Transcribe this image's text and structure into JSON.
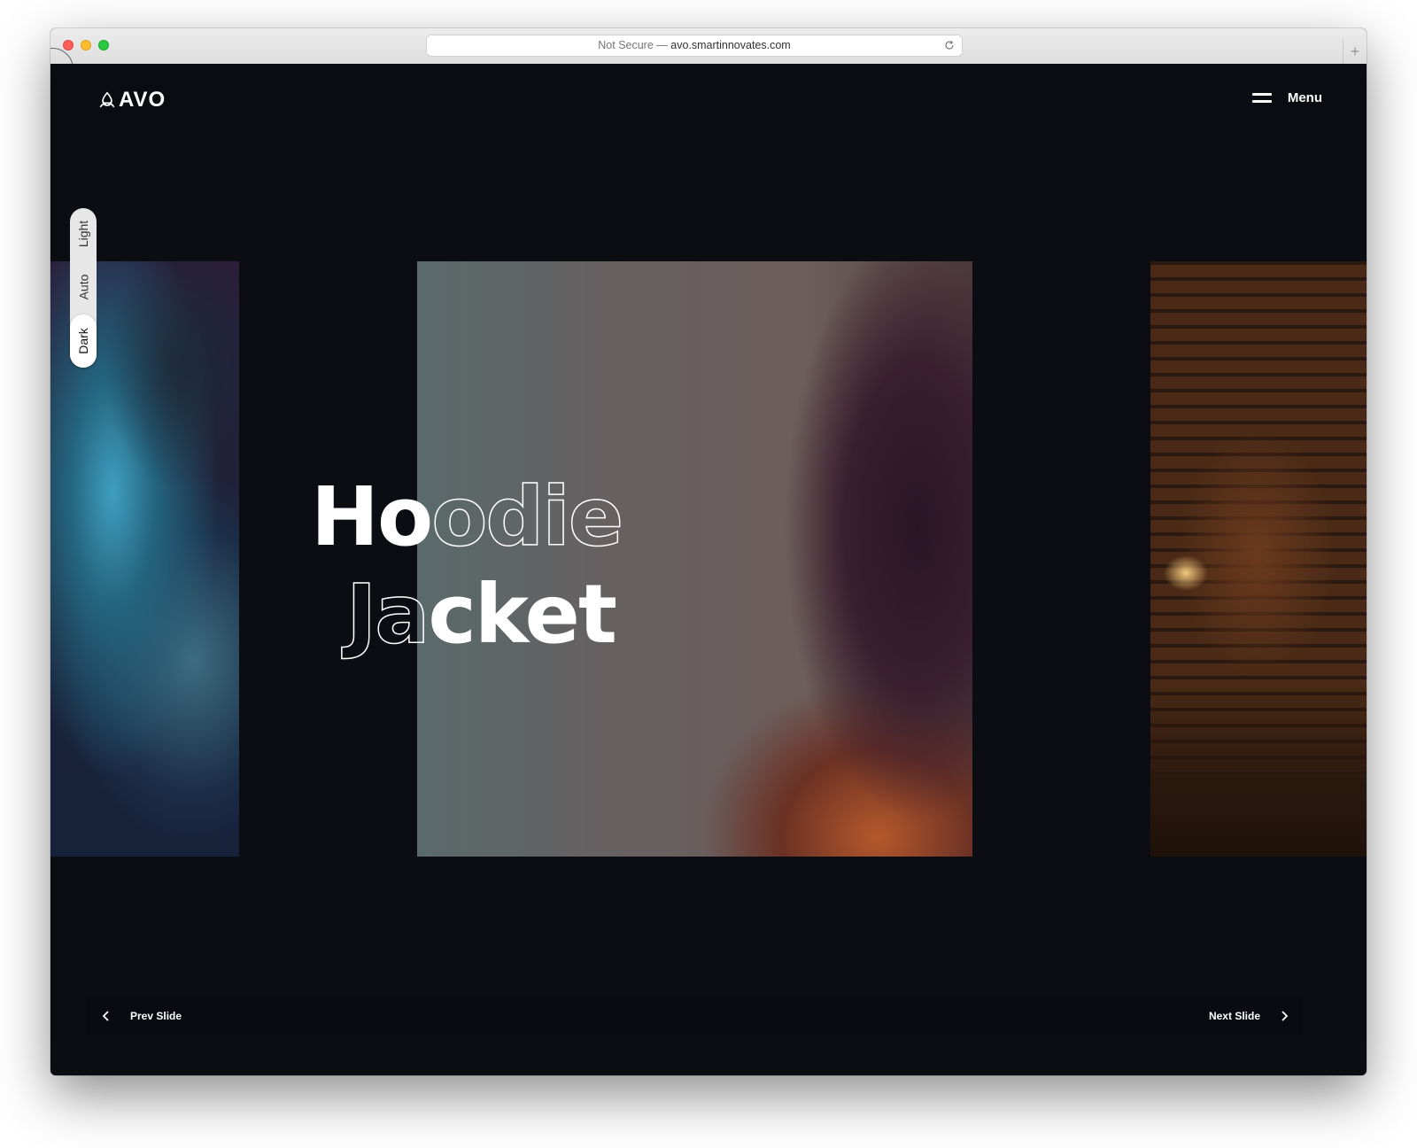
{
  "browser": {
    "url_prefix": "Not Secure — ",
    "url_host": "avo.smartinnovates.com",
    "new_tab_symbol": "+"
  },
  "header": {
    "logo_text": "AVO",
    "logo_icon": "triquetra-icon",
    "menu_label": "Menu",
    "menu_icon": "hamburger-icon"
  },
  "theme_switcher": {
    "options": [
      "Light",
      "Auto",
      "Dark"
    ],
    "active": "Dark"
  },
  "slider": {
    "headline_line1_solid": "Ho",
    "headline_line1_outline": "odie",
    "headline_line2_outline": "Ja",
    "headline_line2_solid": "cket",
    "slides": [
      {
        "name": "hooded-man-portrait"
      },
      {
        "name": "fur-hood-jacket"
      },
      {
        "name": "library-interior"
      }
    ]
  },
  "navigation": {
    "prev_label": "Prev Slide",
    "next_label": "Next Slide",
    "prev_icon": "chevron-left-icon",
    "next_icon": "chevron-right-icon"
  },
  "colors": {
    "background": "#0b0d13",
    "text": "#ffffff",
    "switcher_bg": "#e7e7e7"
  }
}
